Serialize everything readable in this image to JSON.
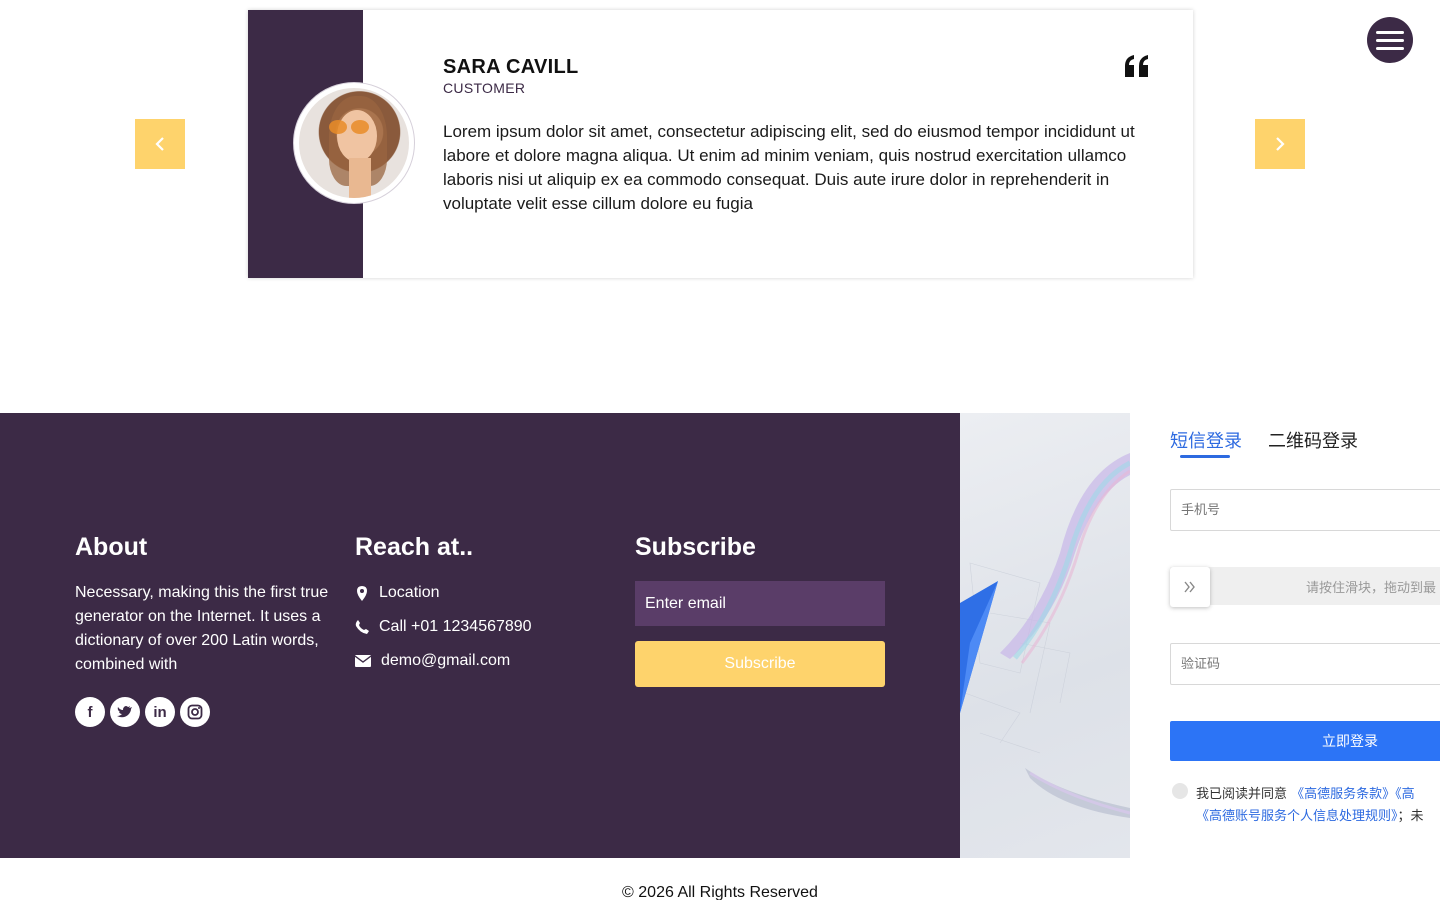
{
  "testimonial": {
    "name": "SARA CAVILL",
    "role": "CUSTOMER",
    "text": "Lorem ipsum dolor sit amet, consectetur adipiscing elit, sed do eiusmod tempor incididunt ut labore et dolore magna aliqua. Ut enim ad minim veniam, quis nostrud exercitation ullamco laboris nisi ut aliquip ex ea commodo consequat. Duis aute irure dolor in reprehenderit in voluptate velit esse cillum dolore eu fugia"
  },
  "footer": {
    "about": {
      "heading": "About",
      "text": "Necessary, making this the first true generator on the Internet. It uses a dictionary of over 200 Latin words, combined with"
    },
    "reach": {
      "heading": "Reach at..",
      "location": "Location",
      "phone": "Call +01 1234567890",
      "email": "demo@gmail.com"
    },
    "subscribe": {
      "heading": "Subscribe",
      "placeholder": "Enter email",
      "button": "Subscribe"
    },
    "social_icons": [
      "facebook-icon",
      "twitter-icon",
      "linkedin-icon",
      "instagram-icon"
    ]
  },
  "copyright": "© 2026 All Rights Reserved",
  "login": {
    "tab_sms": "短信登录",
    "tab_qr": "二维码登录",
    "phone_placeholder": "手机号",
    "slider_hint": "请按住滑块，拖动到最",
    "code_placeholder": "验证码",
    "submit": "立即登录",
    "agree_prefix": "我已阅读并同意",
    "agree_link1": "《高德服务条款》",
    "agree_link2": "《高",
    "agree_link3": "《高德账号服务个人信息处理规则》",
    "agree_suffix": "；未"
  },
  "colors": {
    "brand_purple": "#3c2a46",
    "accent_yellow": "#fed36c",
    "input_purple": "#5a3d68",
    "login_blue": "#2c74f6"
  }
}
